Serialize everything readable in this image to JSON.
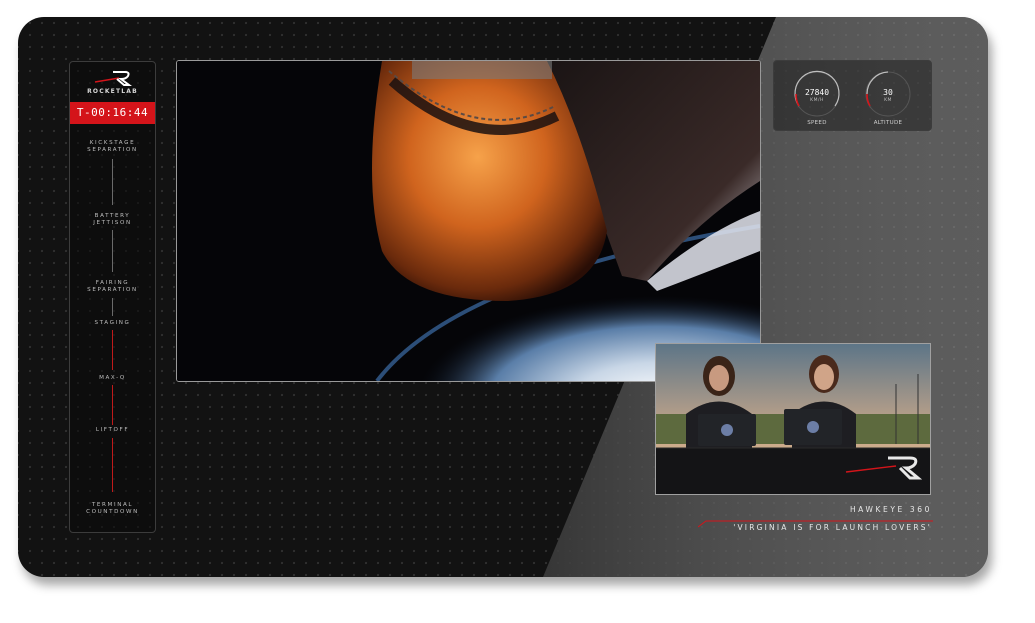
{
  "brand": {
    "logo_text": "ROCKETLAB",
    "accent": "#d4141a"
  },
  "timeline": {
    "countdown": "T-00:16:44",
    "events": [
      {
        "label": "KICKSTAGE\nSEPARATION"
      },
      {
        "label": "BATTERY\nJETTISON"
      },
      {
        "label": "FAIRING\nSEPARATION"
      },
      {
        "label": "STAGING"
      },
      {
        "label": "MAX-Q"
      },
      {
        "label": "LIFTOFF"
      },
      {
        "label": "TERMINAL\nCOUNTDOWN"
      }
    ]
  },
  "telemetry": {
    "speed": {
      "value": "27840",
      "unit": "KM/H",
      "label": "SPEED"
    },
    "altitude": {
      "value": "30",
      "unit": "KM",
      "label": "ALTITUDE"
    }
  },
  "mission": {
    "name": "HAWKEYE 360",
    "tagline": "'VIRGINIA IS FOR LAUNCH LOVERS'"
  },
  "icons": {
    "logo": "rocketlab-r-logo",
    "speed_gauge": "speed-gauge-icon",
    "altitude_gauge": "altitude-gauge-icon"
  }
}
